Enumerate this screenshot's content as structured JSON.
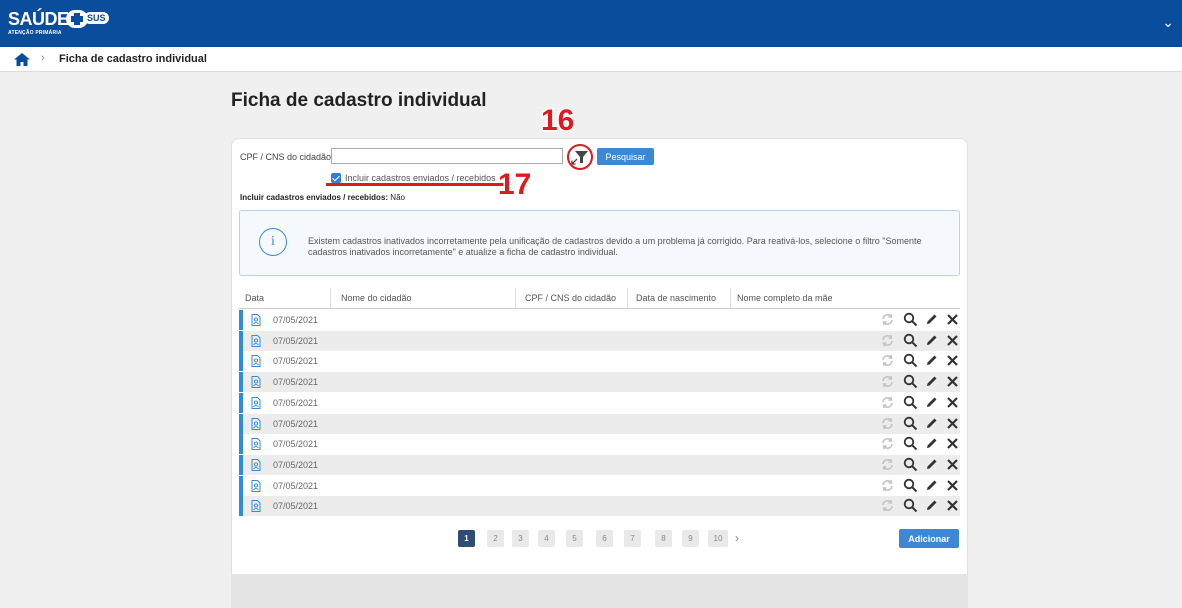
{
  "brand": {
    "logo_text": "SAÚDE",
    "logo_sus": "SUS",
    "logo_subtitle": "ATENÇÃO PRIMÁRIA"
  },
  "header": {
    "chevron": "⌄"
  },
  "breadcrumb": {
    "separator": "›",
    "current": "Ficha de cadastro individual"
  },
  "page": {
    "title": "Ficha de cadastro individual"
  },
  "search": {
    "label": "CPF / CNS do cidadão",
    "value": "",
    "button_label": "Pesquisar",
    "checkbox_label": "Incluir cadastros enviados / recebidos",
    "checkbox_checked": true
  },
  "annotations": {
    "filter_number": "16",
    "checkbox_number": "17"
  },
  "filter_summary": {
    "label": "Incluir cadastros enviados / recebidos:",
    "value": "Não"
  },
  "info": {
    "icon": "i",
    "text": "Existem cadastros inativados incorretamente pela unificação de cadastros devido a um problema já corrigido. Para reativá-los, selecione o filtro \"Somente cadastros inativados incorretamente\" e atualize a ficha de cadastro individual."
  },
  "table": {
    "columns": [
      "Data",
      "Nome do cidadão",
      "CPF / CNS do cidadão",
      "Data de nascimento",
      "Nome completo da mãe"
    ],
    "rows": [
      {
        "date": "07/05/2021"
      },
      {
        "date": "07/05/2021"
      },
      {
        "date": "07/05/2021"
      },
      {
        "date": "07/05/2021"
      },
      {
        "date": "07/05/2021"
      },
      {
        "date": "07/05/2021"
      },
      {
        "date": "07/05/2021"
      },
      {
        "date": "07/05/2021"
      },
      {
        "date": "07/05/2021"
      },
      {
        "date": "07/05/2021"
      }
    ]
  },
  "pagination": {
    "pages": [
      "1",
      "2",
      "3",
      "4",
      "5",
      "6",
      "7",
      "8",
      "9",
      "10"
    ],
    "current": "1",
    "next": "›"
  },
  "actions": {
    "add_label": "Adicionar"
  },
  "colors": {
    "header": "#0a4d9c",
    "primary": "#3c88d4",
    "annotation": "#e0191f",
    "row_marker": "#2f8be0"
  }
}
